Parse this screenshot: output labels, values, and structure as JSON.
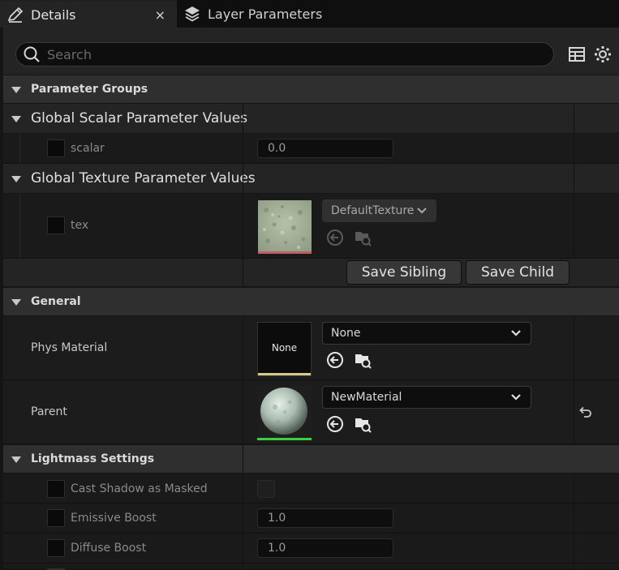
{
  "tabs": [
    {
      "label": "Details",
      "icon": "pencil-icon",
      "active": true
    },
    {
      "label": "Layer Parameters",
      "icon": "layers-icon",
      "active": false
    }
  ],
  "tab_close": "×",
  "search": {
    "placeholder": "Search",
    "value": ""
  },
  "toolbar": {
    "table_icon": "table-view-icon",
    "settings_icon": "gear-icon"
  },
  "categories": {
    "parameter_groups": "Parameter Groups",
    "global_scalar": "Global Scalar Parameter Values",
    "global_texture": "Global Texture Parameter Values",
    "general": "General",
    "lightmass": "Lightmass Settings"
  },
  "scalar_param": {
    "label": "scalar",
    "value": "0.0",
    "enabled": false
  },
  "texture_param": {
    "label": "tex",
    "asset": "DefaultTexture",
    "enabled": false
  },
  "actions": {
    "save_sibling": "Save Sibling",
    "save_child": "Save Child"
  },
  "general": {
    "phys_material": {
      "label": "Phys Material",
      "value": "None",
      "thumb_text": "None"
    },
    "parent": {
      "label": "Parent",
      "value": "NewMaterial"
    }
  },
  "lightmass": {
    "cast_shadow": {
      "label": "Cast Shadow as Masked",
      "checked": false
    },
    "emissive_boost": {
      "label": "Emissive Boost",
      "value": "1.0"
    },
    "diffuse_boost": {
      "label": "Diffuse Boost",
      "value": "1.0"
    }
  },
  "colors": {
    "background": "#242424",
    "category": "#2f2f2f",
    "property_row": "#1a1a1a",
    "field": "#0e0e0e",
    "texture_underline": "#c06060",
    "phys_underline": "#d6c98a",
    "material_underline": "#3ecf3e"
  }
}
